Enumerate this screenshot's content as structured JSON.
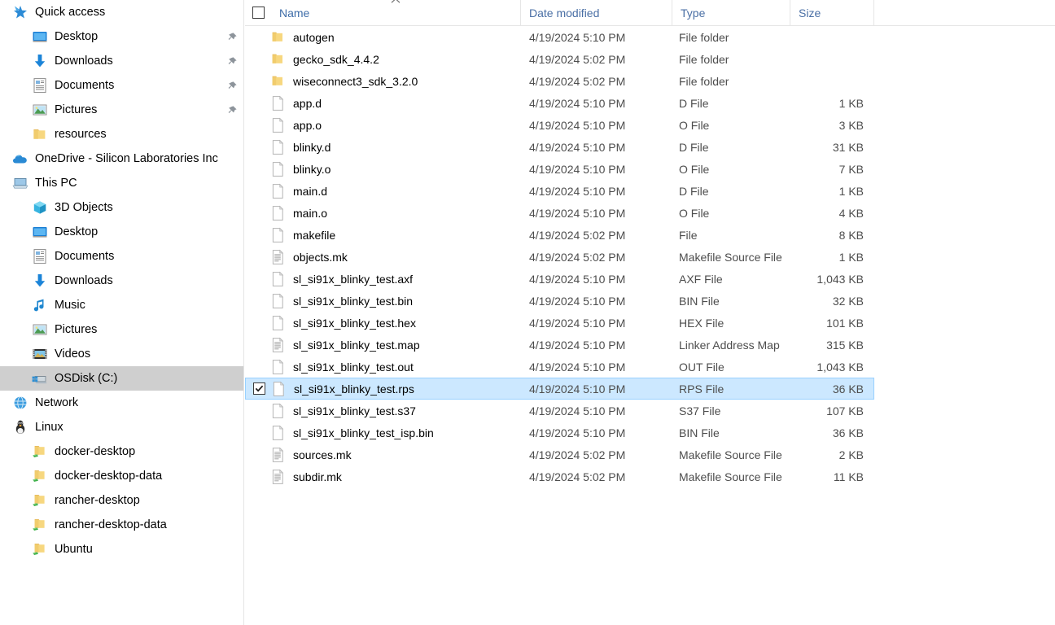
{
  "nav_pane": {
    "items": [
      {
        "label": "Quick access",
        "icon": "star-pin-icon",
        "indent": 0,
        "pinned": false,
        "selected": false
      },
      {
        "label": "Desktop",
        "icon": "desktop-icon",
        "indent": 1,
        "pinned": true,
        "selected": false
      },
      {
        "label": "Downloads",
        "icon": "download-icon",
        "indent": 1,
        "pinned": true,
        "selected": false
      },
      {
        "label": "Documents",
        "icon": "documents-icon",
        "indent": 1,
        "pinned": true,
        "selected": false
      },
      {
        "label": "Pictures",
        "icon": "pictures-icon",
        "indent": 1,
        "pinned": true,
        "selected": false
      },
      {
        "label": "resources",
        "icon": "folder-icon",
        "indent": 1,
        "pinned": false,
        "selected": false
      },
      {
        "label": "OneDrive - Silicon Laboratories Inc",
        "icon": "onedrive-icon",
        "indent": 0,
        "pinned": false,
        "selected": false
      },
      {
        "label": "This PC",
        "icon": "thispc-icon",
        "indent": 0,
        "pinned": false,
        "selected": false
      },
      {
        "label": "3D Objects",
        "icon": "3dobjects-icon",
        "indent": 1,
        "pinned": false,
        "selected": false
      },
      {
        "label": "Desktop",
        "icon": "desktop-icon",
        "indent": 1,
        "pinned": false,
        "selected": false
      },
      {
        "label": "Documents",
        "icon": "documents-icon",
        "indent": 1,
        "pinned": false,
        "selected": false
      },
      {
        "label": "Downloads",
        "icon": "download-icon",
        "indent": 1,
        "pinned": false,
        "selected": false
      },
      {
        "label": "Music",
        "icon": "music-icon",
        "indent": 1,
        "pinned": false,
        "selected": false
      },
      {
        "label": "Pictures",
        "icon": "pictures-icon",
        "indent": 1,
        "pinned": false,
        "selected": false
      },
      {
        "label": "Videos",
        "icon": "videos-icon",
        "indent": 1,
        "pinned": false,
        "selected": false
      },
      {
        "label": "OSDisk (C:)",
        "icon": "harddrive-icon",
        "indent": 1,
        "pinned": false,
        "selected": true
      },
      {
        "label": "Network",
        "icon": "network-icon",
        "indent": 0,
        "pinned": false,
        "selected": false
      },
      {
        "label": "Linux",
        "icon": "linux-icon",
        "indent": 0,
        "pinned": false,
        "selected": false
      },
      {
        "label": "docker-desktop",
        "icon": "network-folder-icon",
        "indent": 1,
        "pinned": false,
        "selected": false
      },
      {
        "label": "docker-desktop-data",
        "icon": "network-folder-icon",
        "indent": 1,
        "pinned": false,
        "selected": false
      },
      {
        "label": "rancher-desktop",
        "icon": "network-folder-icon",
        "indent": 1,
        "pinned": false,
        "selected": false
      },
      {
        "label": "rancher-desktop-data",
        "icon": "network-folder-icon",
        "indent": 1,
        "pinned": false,
        "selected": false
      },
      {
        "label": "Ubuntu",
        "icon": "network-folder-icon",
        "indent": 1,
        "pinned": false,
        "selected": false
      }
    ]
  },
  "file_list": {
    "columns": {
      "name": "Name",
      "date_modified": "Date modified",
      "type": "Type",
      "size": "Size"
    },
    "sort_column": "Name",
    "sort_direction": "ascending",
    "header_checkbox_checked": false,
    "rows": [
      {
        "name": "autogen",
        "date": "4/19/2024 5:10 PM",
        "type": "File folder",
        "size": "",
        "icon": "folder-icon",
        "selected": false,
        "checked": false
      },
      {
        "name": "gecko_sdk_4.4.2",
        "date": "4/19/2024 5:02 PM",
        "type": "File folder",
        "size": "",
        "icon": "folder-icon",
        "selected": false,
        "checked": false
      },
      {
        "name": "wiseconnect3_sdk_3.2.0",
        "date": "4/19/2024 5:02 PM",
        "type": "File folder",
        "size": "",
        "icon": "folder-icon",
        "selected": false,
        "checked": false
      },
      {
        "name": "app.d",
        "date": "4/19/2024 5:10 PM",
        "type": "D File",
        "size": "1 KB",
        "icon": "blank-file-icon",
        "selected": false,
        "checked": false
      },
      {
        "name": "app.o",
        "date": "4/19/2024 5:10 PM",
        "type": "O File",
        "size": "3 KB",
        "icon": "blank-file-icon",
        "selected": false,
        "checked": false
      },
      {
        "name": "blinky.d",
        "date": "4/19/2024 5:10 PM",
        "type": "D File",
        "size": "31 KB",
        "icon": "blank-file-icon",
        "selected": false,
        "checked": false
      },
      {
        "name": "blinky.o",
        "date": "4/19/2024 5:10 PM",
        "type": "O File",
        "size": "7 KB",
        "icon": "blank-file-icon",
        "selected": false,
        "checked": false
      },
      {
        "name": "main.d",
        "date": "4/19/2024 5:10 PM",
        "type": "D File",
        "size": "1 KB",
        "icon": "blank-file-icon",
        "selected": false,
        "checked": false
      },
      {
        "name": "main.o",
        "date": "4/19/2024 5:10 PM",
        "type": "O File",
        "size": "4 KB",
        "icon": "blank-file-icon",
        "selected": false,
        "checked": false
      },
      {
        "name": "makefile",
        "date": "4/19/2024 5:02 PM",
        "type": "File",
        "size": "8 KB",
        "icon": "blank-file-icon",
        "selected": false,
        "checked": false
      },
      {
        "name": "objects.mk",
        "date": "4/19/2024 5:02 PM",
        "type": "Makefile Source File",
        "size": "1 KB",
        "icon": "text-file-icon",
        "selected": false,
        "checked": false
      },
      {
        "name": "sl_si91x_blinky_test.axf",
        "date": "4/19/2024 5:10 PM",
        "type": "AXF File",
        "size": "1,043 KB",
        "icon": "blank-file-icon",
        "selected": false,
        "checked": false
      },
      {
        "name": "sl_si91x_blinky_test.bin",
        "date": "4/19/2024 5:10 PM",
        "type": "BIN File",
        "size": "32 KB",
        "icon": "blank-file-icon",
        "selected": false,
        "checked": false
      },
      {
        "name": "sl_si91x_blinky_test.hex",
        "date": "4/19/2024 5:10 PM",
        "type": "HEX File",
        "size": "101 KB",
        "icon": "blank-file-icon",
        "selected": false,
        "checked": false
      },
      {
        "name": "sl_si91x_blinky_test.map",
        "date": "4/19/2024 5:10 PM",
        "type": "Linker Address Map",
        "size": "315 KB",
        "icon": "text-file-icon",
        "selected": false,
        "checked": false
      },
      {
        "name": "sl_si91x_blinky_test.out",
        "date": "4/19/2024 5:10 PM",
        "type": "OUT File",
        "size": "1,043 KB",
        "icon": "blank-file-icon",
        "selected": false,
        "checked": false
      },
      {
        "name": "sl_si91x_blinky_test.rps",
        "date": "4/19/2024 5:10 PM",
        "type": "RPS File",
        "size": "36 KB",
        "icon": "blank-file-icon",
        "selected": true,
        "checked": true
      },
      {
        "name": "sl_si91x_blinky_test.s37",
        "date": "4/19/2024 5:10 PM",
        "type": "S37 File",
        "size": "107 KB",
        "icon": "blank-file-icon",
        "selected": false,
        "checked": false
      },
      {
        "name": "sl_si91x_blinky_test_isp.bin",
        "date": "4/19/2024 5:10 PM",
        "type": "BIN File",
        "size": "36 KB",
        "icon": "blank-file-icon",
        "selected": false,
        "checked": false
      },
      {
        "name": "sources.mk",
        "date": "4/19/2024 5:02 PM",
        "type": "Makefile Source File",
        "size": "2 KB",
        "icon": "text-file-icon",
        "selected": false,
        "checked": false
      },
      {
        "name": "subdir.mk",
        "date": "4/19/2024 5:02 PM",
        "type": "Makefile Source File",
        "size": "11 KB",
        "icon": "text-file-icon",
        "selected": false,
        "checked": false
      }
    ]
  },
  "colors": {
    "selection_fill": "#cce8ff",
    "selection_border": "#99d1ff",
    "nav_selection_fill": "#cfcfcf",
    "header_text": "#4a6fa5",
    "secondary_text": "#4d4d4d",
    "folder_yellow": "#f6d27f"
  }
}
